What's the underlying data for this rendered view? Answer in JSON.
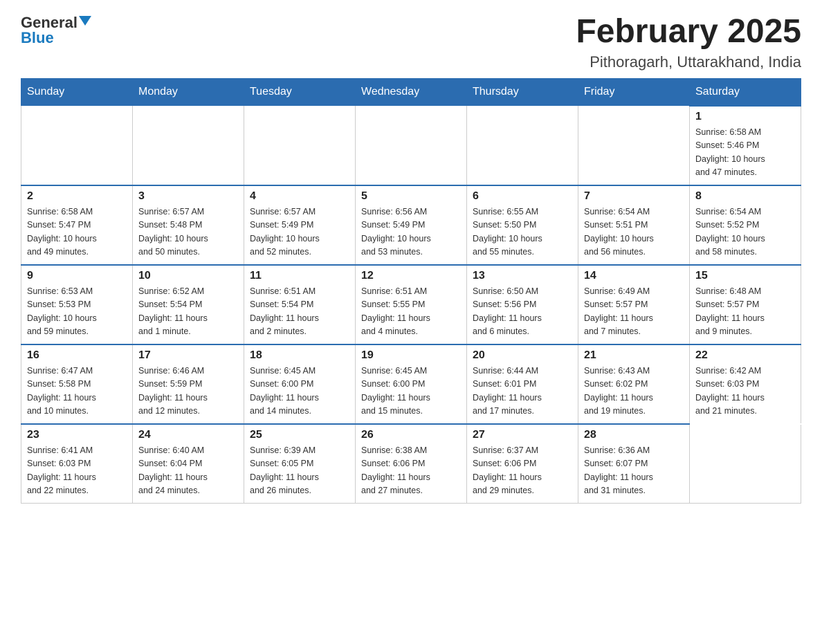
{
  "logo": {
    "part1": "General",
    "part2": "Blue"
  },
  "title": "February 2025",
  "subtitle": "Pithoragarh, Uttarakhand, India",
  "days_of_week": [
    "Sunday",
    "Monday",
    "Tuesday",
    "Wednesday",
    "Thursday",
    "Friday",
    "Saturday"
  ],
  "weeks": [
    [
      {
        "day": "",
        "info": ""
      },
      {
        "day": "",
        "info": ""
      },
      {
        "day": "",
        "info": ""
      },
      {
        "day": "",
        "info": ""
      },
      {
        "day": "",
        "info": ""
      },
      {
        "day": "",
        "info": ""
      },
      {
        "day": "1",
        "info": "Sunrise: 6:58 AM\nSunset: 5:46 PM\nDaylight: 10 hours\nand 47 minutes."
      }
    ],
    [
      {
        "day": "2",
        "info": "Sunrise: 6:58 AM\nSunset: 5:47 PM\nDaylight: 10 hours\nand 49 minutes."
      },
      {
        "day": "3",
        "info": "Sunrise: 6:57 AM\nSunset: 5:48 PM\nDaylight: 10 hours\nand 50 minutes."
      },
      {
        "day": "4",
        "info": "Sunrise: 6:57 AM\nSunset: 5:49 PM\nDaylight: 10 hours\nand 52 minutes."
      },
      {
        "day": "5",
        "info": "Sunrise: 6:56 AM\nSunset: 5:49 PM\nDaylight: 10 hours\nand 53 minutes."
      },
      {
        "day": "6",
        "info": "Sunrise: 6:55 AM\nSunset: 5:50 PM\nDaylight: 10 hours\nand 55 minutes."
      },
      {
        "day": "7",
        "info": "Sunrise: 6:54 AM\nSunset: 5:51 PM\nDaylight: 10 hours\nand 56 minutes."
      },
      {
        "day": "8",
        "info": "Sunrise: 6:54 AM\nSunset: 5:52 PM\nDaylight: 10 hours\nand 58 minutes."
      }
    ],
    [
      {
        "day": "9",
        "info": "Sunrise: 6:53 AM\nSunset: 5:53 PM\nDaylight: 10 hours\nand 59 minutes."
      },
      {
        "day": "10",
        "info": "Sunrise: 6:52 AM\nSunset: 5:54 PM\nDaylight: 11 hours\nand 1 minute."
      },
      {
        "day": "11",
        "info": "Sunrise: 6:51 AM\nSunset: 5:54 PM\nDaylight: 11 hours\nand 2 minutes."
      },
      {
        "day": "12",
        "info": "Sunrise: 6:51 AM\nSunset: 5:55 PM\nDaylight: 11 hours\nand 4 minutes."
      },
      {
        "day": "13",
        "info": "Sunrise: 6:50 AM\nSunset: 5:56 PM\nDaylight: 11 hours\nand 6 minutes."
      },
      {
        "day": "14",
        "info": "Sunrise: 6:49 AM\nSunset: 5:57 PM\nDaylight: 11 hours\nand 7 minutes."
      },
      {
        "day": "15",
        "info": "Sunrise: 6:48 AM\nSunset: 5:57 PM\nDaylight: 11 hours\nand 9 minutes."
      }
    ],
    [
      {
        "day": "16",
        "info": "Sunrise: 6:47 AM\nSunset: 5:58 PM\nDaylight: 11 hours\nand 10 minutes."
      },
      {
        "day": "17",
        "info": "Sunrise: 6:46 AM\nSunset: 5:59 PM\nDaylight: 11 hours\nand 12 minutes."
      },
      {
        "day": "18",
        "info": "Sunrise: 6:45 AM\nSunset: 6:00 PM\nDaylight: 11 hours\nand 14 minutes."
      },
      {
        "day": "19",
        "info": "Sunrise: 6:45 AM\nSunset: 6:00 PM\nDaylight: 11 hours\nand 15 minutes."
      },
      {
        "day": "20",
        "info": "Sunrise: 6:44 AM\nSunset: 6:01 PM\nDaylight: 11 hours\nand 17 minutes."
      },
      {
        "day": "21",
        "info": "Sunrise: 6:43 AM\nSunset: 6:02 PM\nDaylight: 11 hours\nand 19 minutes."
      },
      {
        "day": "22",
        "info": "Sunrise: 6:42 AM\nSunset: 6:03 PM\nDaylight: 11 hours\nand 21 minutes."
      }
    ],
    [
      {
        "day": "23",
        "info": "Sunrise: 6:41 AM\nSunset: 6:03 PM\nDaylight: 11 hours\nand 22 minutes."
      },
      {
        "day": "24",
        "info": "Sunrise: 6:40 AM\nSunset: 6:04 PM\nDaylight: 11 hours\nand 24 minutes."
      },
      {
        "day": "25",
        "info": "Sunrise: 6:39 AM\nSunset: 6:05 PM\nDaylight: 11 hours\nand 26 minutes."
      },
      {
        "day": "26",
        "info": "Sunrise: 6:38 AM\nSunset: 6:06 PM\nDaylight: 11 hours\nand 27 minutes."
      },
      {
        "day": "27",
        "info": "Sunrise: 6:37 AM\nSunset: 6:06 PM\nDaylight: 11 hours\nand 29 minutes."
      },
      {
        "day": "28",
        "info": "Sunrise: 6:36 AM\nSunset: 6:07 PM\nDaylight: 11 hours\nand 31 minutes."
      },
      {
        "day": "",
        "info": ""
      }
    ]
  ]
}
